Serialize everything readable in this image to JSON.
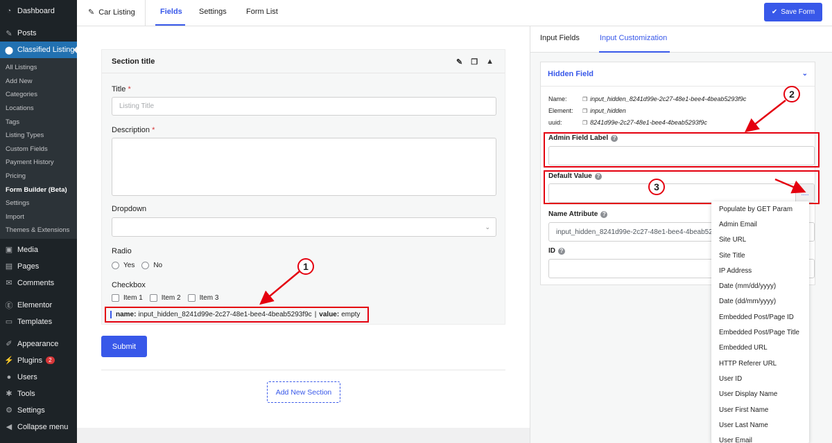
{
  "sidebar": {
    "top_items": [
      {
        "label": "Dashboard",
        "icon": "dashboard-icon"
      },
      {
        "label": "Posts",
        "icon": "pin-icon"
      },
      {
        "label": "Classified Listing",
        "icon": "location-icon"
      }
    ],
    "sub_items": [
      "All Listings",
      "Add New",
      "Categories",
      "Locations",
      "Tags",
      "Listing Types",
      "Custom Fields",
      "Payment History",
      "Pricing",
      "Form Builder (Beta)",
      "Settings",
      "Import",
      "Themes & Extensions"
    ],
    "bottom_items": [
      {
        "label": "Media",
        "icon": "media-icon"
      },
      {
        "label": "Pages",
        "icon": "pages-icon"
      },
      {
        "label": "Comments",
        "icon": "comment-icon"
      },
      {
        "label": "Elementor",
        "icon": "elementor-icon"
      },
      {
        "label": "Templates",
        "icon": "folder-icon"
      },
      {
        "label": "Appearance",
        "icon": "brush-icon"
      },
      {
        "label": "Plugins",
        "icon": "plugin-icon",
        "badge": "2"
      },
      {
        "label": "Users",
        "icon": "user-icon"
      },
      {
        "label": "Tools",
        "icon": "wrench-icon"
      },
      {
        "label": "Settings",
        "icon": "settings-icon"
      },
      {
        "label": "Collapse menu",
        "icon": "collapse-icon"
      }
    ]
  },
  "topbar": {
    "back_label": "Car Listing",
    "tabs": [
      "Fields",
      "Settings",
      "Form List"
    ],
    "save_label": "Save Form"
  },
  "form": {
    "section_title": "Section title",
    "title_label": "Title",
    "title_placeholder": "Listing Title",
    "description_label": "Description",
    "required_mark": "*",
    "dropdown_label": "Dropdown",
    "radio_label": "Radio",
    "radio_options": [
      "Yes",
      "No"
    ],
    "checkbox_label": "Checkbox",
    "checkbox_options": [
      "Item 1",
      "Item 2",
      "Item 3"
    ],
    "hidden_name_key": "name:",
    "hidden_name_value": "input_hidden_8241d99e-2c27-48e1-bee4-4beab5293f9c",
    "hidden_sep": "|",
    "hidden_value_key": "value:",
    "hidden_value_value": "empty",
    "submit_label": "Submit",
    "add_section_label": "Add New Section"
  },
  "panel": {
    "tabs": [
      "Input Fields",
      "Input Customization"
    ],
    "card_title": "Hidden Field",
    "meta": [
      {
        "key": "Name:",
        "value": "input_hidden_8241d99e-2c27-48e1-bee4-4beab5293f9c"
      },
      {
        "key": "Element:",
        "value": "input_hidden"
      },
      {
        "key": "uuid:",
        "value": "8241d99e-2c27-48e1-bee4-4beab5293f9c"
      }
    ],
    "admin_label": "Admin Field Label",
    "default_label": "Default Value",
    "dots_label": "....",
    "name_attr_label": "Name Attribute",
    "name_attr_value": "input_hidden_8241d99e-2c27-48e1-bee4-4beab5293f9c",
    "id_label": "ID",
    "help_glyph": "?"
  },
  "dropdown_items": [
    "Populate by GET Param",
    "Admin Email",
    "Site URL",
    "Site Title",
    "IP Address",
    "Date (mm/dd/yyyy)",
    "Date (dd/mm/yyyy)",
    "Embedded Post/Page ID",
    "Embedded Post/Page Title",
    "Embedded URL",
    "HTTP Referer URL",
    "User ID",
    "User Display Name",
    "User First Name",
    "User Last Name",
    "User Email"
  ],
  "annotations": [
    "1",
    "2",
    "3"
  ],
  "colors": {
    "accent": "#3858e9",
    "annotation": "#e4000f",
    "sidebar": "#1d2327",
    "wp_blue": "#2271b1"
  }
}
